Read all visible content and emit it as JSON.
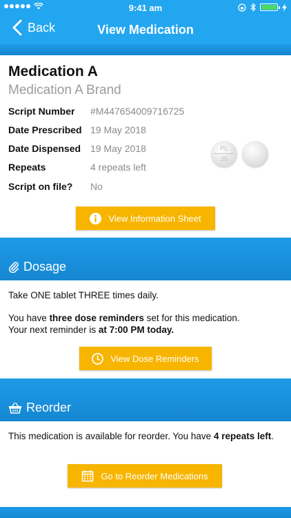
{
  "status_bar": {
    "time": "9:41 am"
  },
  "nav": {
    "back_label": "Back",
    "title": "View Medication"
  },
  "medication": {
    "name": "Medication A",
    "brand": "Medication A Brand",
    "details": [
      {
        "label": "Script Number",
        "value": "#M447654009716725"
      },
      {
        "label": "Date Prescribed",
        "value": "19 May 2018"
      },
      {
        "label": "Date Dispensed",
        "value": "19 May 2018"
      },
      {
        "label": "Repeats",
        "value": "4 repeats left"
      },
      {
        "label": "Script on file?",
        "value": "No"
      }
    ],
    "pill_imprint_top": "PL",
    "pill_imprint_bottom": "25",
    "info_button": "View Information Sheet"
  },
  "dosage": {
    "header": "Dosage",
    "instruction": "Take ONE tablet THREE times daily.",
    "reminder_prefix": "You have ",
    "reminder_count": "three dose reminders",
    "reminder_suffix": " set for this medication.",
    "next_prefix": "Your next reminder is ",
    "next_time": "at 7:00 PM today.",
    "button": "View Dose Reminders"
  },
  "reorder": {
    "header": "Reorder",
    "text_prefix": "This medication is available for reorder. You have ",
    "repeats_bold": "4 repeats left",
    "text_suffix": ".",
    "button": "Go to Reorder Medications"
  },
  "colors": {
    "accent": "#f7b500",
    "primary": "#22a6f0"
  }
}
